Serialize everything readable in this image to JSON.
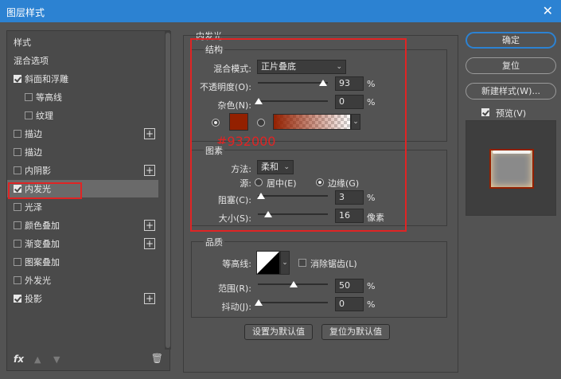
{
  "window": {
    "title": "图层样式",
    "close_glyph": "✕"
  },
  "styles_list": {
    "header": "样式",
    "blend_options": "混合选项",
    "items": [
      {
        "label": "斜面和浮雕",
        "checked": true,
        "plus": false
      },
      {
        "label": "等高线",
        "checked": false,
        "plus": false
      },
      {
        "label": "纹理",
        "checked": false,
        "plus": false
      },
      {
        "label": "描边",
        "checked": false,
        "plus": true
      },
      {
        "label": "描边",
        "checked": false,
        "plus": false
      },
      {
        "label": "内阴影",
        "checked": false,
        "plus": true
      },
      {
        "label": "内发光",
        "checked": true,
        "plus": false
      },
      {
        "label": "光泽",
        "checked": false,
        "plus": false
      },
      {
        "label": "颜色叠加",
        "checked": false,
        "plus": true
      },
      {
        "label": "渐变叠加",
        "checked": false,
        "plus": true
      },
      {
        "label": "图案叠加",
        "checked": false,
        "plus": false
      },
      {
        "label": "外发光",
        "checked": false,
        "plus": false
      },
      {
        "label": "投影",
        "checked": true,
        "plus": true
      }
    ],
    "footer": {
      "fx": "fx",
      "up_icon": "▲",
      "down_icon": "▼",
      "trash_icon": "🗑"
    }
  },
  "inner_glow": {
    "section_title": "内发光",
    "structure": {
      "title": "结构",
      "blend_mode_label": "混合模式:",
      "blend_mode_value": "正片叠底",
      "opacity_label": "不透明度(O):",
      "opacity_value": "93",
      "opacity_unit": "%",
      "noise_label": "杂色(N):",
      "noise_value": "0",
      "noise_unit": "%",
      "color_hex_note": "#932000",
      "glow_color": "#932000"
    },
    "elements": {
      "title": "图素",
      "method_label": "方法:",
      "method_value": "柔和",
      "source_label": "源:",
      "source_center": "居中(E)",
      "source_edge": "边缘(G)",
      "choke_label": "阻塞(C):",
      "choke_value": "3",
      "choke_unit": "%",
      "size_label": "大小(S):",
      "size_value": "16",
      "size_unit": "像素"
    },
    "quality": {
      "title": "品质",
      "contour_label": "等高线:",
      "anti_alias_label": "消除锯齿(L)",
      "range_label": "范围(R):",
      "range_value": "50",
      "range_unit": "%",
      "jitter_label": "抖动(J):",
      "jitter_value": "0",
      "jitter_unit": "%"
    },
    "set_default_label": "设置为默认值",
    "reset_default_label": "复位为默认值"
  },
  "right_buttons": {
    "ok_label": "确定",
    "reset_label": "复位",
    "new_style_label": "新建样式(W)...",
    "preview_label": "预览(V)"
  },
  "colors": {
    "accent": "#2c82d2",
    "highlight_box": "#e02424",
    "glow": "#932000"
  }
}
